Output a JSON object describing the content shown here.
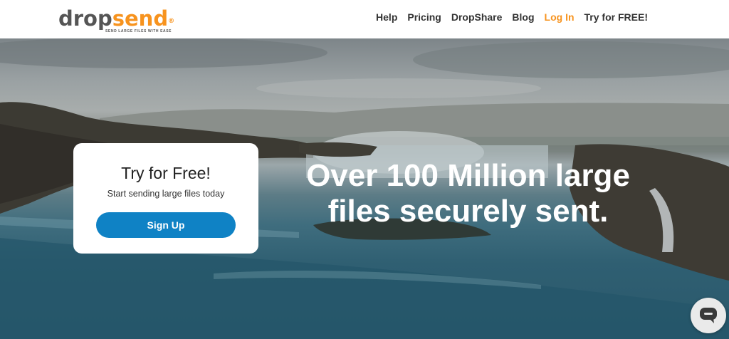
{
  "header": {
    "logo": {
      "drop": "drop",
      "send": "send",
      "reg": "®",
      "tagline": "SEND LARGE FILES WITH EASE"
    },
    "nav": [
      {
        "label": "Help"
      },
      {
        "label": "Pricing"
      },
      {
        "label": "DropShare"
      },
      {
        "label": "Blog"
      },
      {
        "label": "Log In"
      },
      {
        "label": "Try for FREE!"
      }
    ]
  },
  "signup_card": {
    "title": "Try for Free!",
    "subtitle": "Start sending large files today",
    "button_label": "Sign Up"
  },
  "hero": {
    "headline_line1": "Over 100 Million large",
    "headline_line2": "files securely sent."
  },
  "chat_widget": {
    "icon": "chat-bubble-icon"
  },
  "colors": {
    "accent": "#f7931e",
    "button": "#0f82c5",
    "text_dark": "#333333"
  }
}
